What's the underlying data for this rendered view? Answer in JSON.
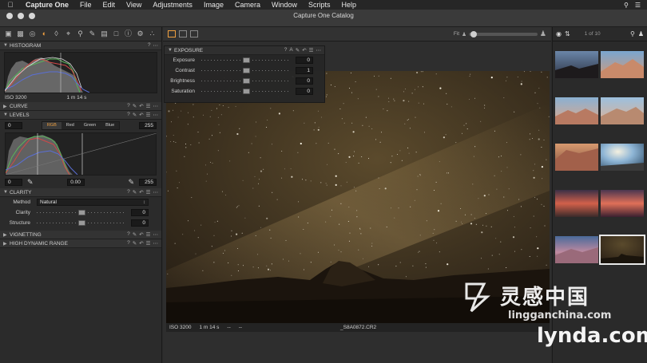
{
  "menubar": {
    "app": "Capture One",
    "items": [
      "File",
      "Edit",
      "View",
      "Adjustments",
      "Image",
      "Camera",
      "Window",
      "Scripts",
      "Help"
    ]
  },
  "window": {
    "title": "Capture One Catalog"
  },
  "left": {
    "histogram": {
      "title": "HISTOGRAM",
      "iso": "ISO 3200",
      "shutter": "1 m 14 s"
    },
    "curve": {
      "title": "CURVE"
    },
    "levels": {
      "title": "LEVELS",
      "in_low": "0",
      "in_high": "255",
      "channels": [
        "RGB",
        "Red",
        "Green",
        "Blue"
      ],
      "active_channel": "RGB",
      "out_low": "0",
      "mid": "0.00",
      "out_high": "255"
    },
    "clarity": {
      "title": "CLARITY",
      "method_label": "Method",
      "method_value": "Natural",
      "clarity_label": "Clarity",
      "clarity_value": "0",
      "clarity_level": 0.5,
      "structure_label": "Structure",
      "structure_value": "0",
      "structure_level": 0.5
    },
    "vignetting": {
      "title": "VIGNETTING"
    },
    "hdr": {
      "title": "HIGH DYNAMIC RANGE"
    }
  },
  "exposure": {
    "title": "EXPOSURE",
    "rows": [
      {
        "label": "Exposure",
        "value": "0",
        "level": 0.5
      },
      {
        "label": "Contrast",
        "value": "1",
        "level": 0.5
      },
      {
        "label": "Brightness",
        "value": "0",
        "level": 0.5
      },
      {
        "label": "Saturation",
        "value": "0",
        "level": 0.5
      }
    ]
  },
  "viewer": {
    "fit_label": "Fit",
    "status": {
      "iso": "ISO 3200",
      "shutter": "1 m 14 s",
      "aperture": "--",
      "focal": "--",
      "filename": "_S8A0872.CR2"
    }
  },
  "browser": {
    "count": "1 of 10",
    "selected_index": 9
  },
  "watermark": {
    "cn": "灵感中国",
    "site": "lingganchina.com",
    "brand": "lynda.com"
  },
  "colors": {
    "accent": "#f0a040",
    "panel": "#2b2b2b",
    "header": "#333333"
  }
}
